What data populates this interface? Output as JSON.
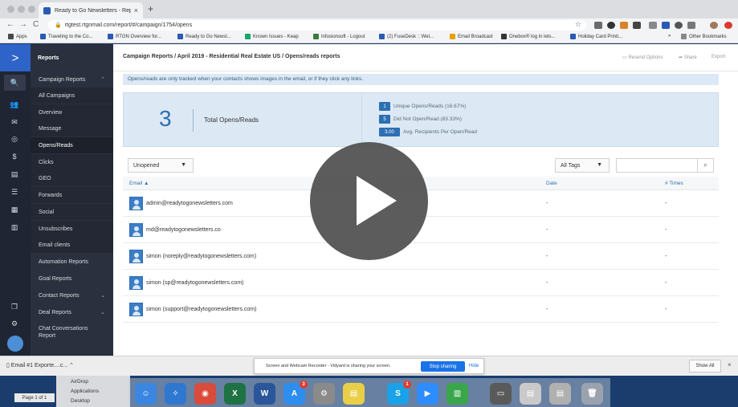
{
  "browser": {
    "tab_title": "Ready to Go Newsletters - Repo",
    "tab_close": "×",
    "new_tab": "+",
    "url": "rtgtest.rtgnmail.com/report/#/campaign/1754/opens",
    "lock_glyph": "🔒",
    "back": "←",
    "forward": "→",
    "reload": "C",
    "star": "☆",
    "bookmarks": [
      {
        "label": "Apps",
        "color": "#4a4a4a"
      },
      {
        "label": "Traveling to the Co...",
        "color": "#2a5ab4"
      },
      {
        "label": "RTGN Overview for...",
        "color": "#2a5ab4"
      },
      {
        "label": "Ready to Go Newsl...",
        "color": "#2a5ab4"
      },
      {
        "label": "Known Issues - Keap",
        "color": "#1aa36b"
      },
      {
        "label": "Infusionsoft - Logout",
        "color": "#3c7a3c"
      },
      {
        "label": "(2) FuseDesk :: Wel...",
        "color": "#2a5ab4"
      },
      {
        "label": "Email Broadcast",
        "color": "#e8a200"
      },
      {
        "label": "Onebox® log in lets...",
        "color": "#333333"
      },
      {
        "label": "Holiday Card Printi...",
        "color": "#2a5ab4"
      }
    ],
    "bookmarks_more": "»",
    "other_bookmarks": "Other Bookmarks"
  },
  "sidebar": {
    "logo": ">",
    "rail_icons": [
      "search-icon",
      "contacts-icon",
      "email-icon",
      "target-icon",
      "dollar-icon",
      "chat-icon",
      "list-icon",
      "document-icon",
      "chart-icon",
      "copy-icon",
      "gear-icon"
    ],
    "rail_glyphs": [
      "🔍",
      "👥",
      "✉",
      "◎",
      "$",
      "▤",
      "☰",
      "▦",
      "▥",
      "❐",
      "⚙"
    ],
    "header": "Reports",
    "items": [
      {
        "label": "Campaign Reports",
        "chev": "⌃",
        "kind": "group"
      },
      {
        "label": "All Campaigns",
        "kind": "sub"
      },
      {
        "label": "Overview",
        "kind": "sub"
      },
      {
        "label": "Message",
        "kind": "sub"
      },
      {
        "label": "Opens/Reads",
        "kind": "active"
      },
      {
        "label": "Clicks",
        "kind": "sub"
      },
      {
        "label": "GEO",
        "kind": "sub"
      },
      {
        "label": "Forwards",
        "kind": "sub"
      },
      {
        "label": "Social",
        "kind": "sub"
      },
      {
        "label": "Unsubscribes",
        "kind": "sub"
      },
      {
        "label": "Email clients",
        "kind": "sub"
      },
      {
        "label": "Automation Reports",
        "kind": "group"
      },
      {
        "label": "Goal Reports",
        "kind": "group"
      },
      {
        "label": "Contact Reports",
        "chev": "⌄",
        "kind": "group"
      },
      {
        "label": "Deal Reports",
        "chev": "⌄",
        "kind": "group"
      },
      {
        "label": "Chat Conversations Report",
        "kind": "group"
      }
    ]
  },
  "header": {
    "breadcrumb": "Campaign Reports  /  April 2019 - Residential Real Estate US  /  Opens/reads reports",
    "resend": "Resend Options",
    "share": "Share",
    "export": "Export"
  },
  "notice": "Opens/reads are only tracked when your contacts shows images in the email, or if they click any links.",
  "stats": {
    "total": "3",
    "total_label": "Total Opens/Reads",
    "rows": [
      {
        "badge": "1",
        "label": "Unique Opens/Reads (16.67%)"
      },
      {
        "badge": "5",
        "label": "Did Not Open/Read (83.33%)"
      },
      {
        "badge": "3.00",
        "label": "Avg. Recipients Per Open/Read"
      }
    ]
  },
  "filters": {
    "status": "Unopened",
    "tags": "All Tags",
    "caret": "▼",
    "search_icon": "⌕",
    "search_placeholder": ""
  },
  "table": {
    "columns": {
      "email": "Email ▲",
      "date": "Date",
      "times": "# Times"
    },
    "rows": [
      {
        "email": "admin@readytogonewsletters.com",
        "date": "-",
        "times": "-"
      },
      {
        "email": "md@readytogonewsletters.co",
        "date": "-",
        "times": "-"
      },
      {
        "email": "simon (noreply@readytogonewsletters.com)",
        "date": "-",
        "times": "-"
      },
      {
        "email": "simon (sp@readytogonewsletters.com)",
        "date": "-",
        "times": "-"
      },
      {
        "email": "simon (support@readytogonewsletters.com)",
        "date": "-",
        "times": "-"
      }
    ]
  },
  "downloads": {
    "file": "Email #1 Exporte....c...",
    "chev": "⌃",
    "share_text": "Screen and Webcam Recorder - Vidyard is sharing your screen.",
    "stop": "Stop sharing",
    "hide": "Hide",
    "show_all": "Show All",
    "close": "×"
  },
  "dock": {
    "finder_items": [
      "AirDrop",
      "Applications",
      "Desktop"
    ],
    "page_info": "Page 1 of 1",
    "apps": [
      {
        "name": "finder-icon",
        "color": "#3a86e0",
        "glyph": "☺"
      },
      {
        "name": "safari-icon",
        "color": "#2f78d0",
        "glyph": "✧"
      },
      {
        "name": "chrome-icon",
        "color": "#d94b3b",
        "glyph": "◉"
      },
      {
        "name": "excel-icon",
        "color": "#1f7244",
        "glyph": "X"
      },
      {
        "name": "word-icon",
        "color": "#2b579a",
        "glyph": "W"
      },
      {
        "name": "app-store-icon",
        "color": "#2d8ef0",
        "glyph": "A",
        "badge": "3"
      },
      {
        "name": "system-preferences-icon",
        "color": "#8a8a8a",
        "glyph": "⚙"
      },
      {
        "name": "stickies-icon",
        "color": "#e9cf48",
        "glyph": "▤"
      },
      {
        "name": "skype-icon",
        "color": "#1aa2e8",
        "glyph": "S",
        "badge": "1"
      },
      {
        "name": "zoom-icon",
        "color": "#2d8cff",
        "glyph": "▶"
      },
      {
        "name": "numbers-icon",
        "color": "#3aa64b",
        "glyph": "▥"
      },
      {
        "name": "preview-icon",
        "color": "#5a5a5a",
        "glyph": "▭"
      },
      {
        "name": "document-icon",
        "color": "#c9c9c9",
        "glyph": "▤"
      },
      {
        "name": "document-icon",
        "color": "#b0b0b0",
        "glyph": "▤"
      },
      {
        "name": "trash-icon",
        "color": "#9aa3ad",
        "glyph": "🗑"
      }
    ]
  }
}
